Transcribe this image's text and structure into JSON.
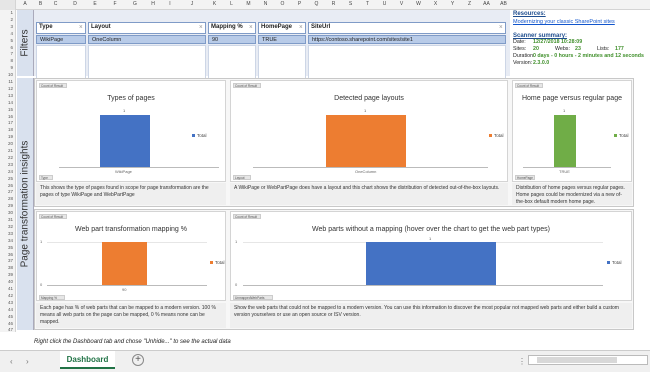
{
  "columns": [
    "A",
    "B",
    "C",
    "D",
    "E",
    "F",
    "G",
    "H",
    "I",
    "J",
    "K",
    "L",
    "M",
    "N",
    "O",
    "P",
    "Q",
    "R",
    "S",
    "T",
    "U",
    "V",
    "W",
    "X",
    "Y",
    "Z",
    "AA",
    "AB"
  ],
  "rows": [
    "1",
    "2",
    "3",
    "4",
    "5",
    "6",
    "7",
    "8",
    "9",
    "10",
    "11",
    "12",
    "13",
    "14",
    "15",
    "16",
    "17",
    "18",
    "19",
    "20",
    "21",
    "22",
    "23",
    "24",
    "25",
    "26",
    "27",
    "28",
    "29",
    "30",
    "31",
    "32",
    "33",
    "34",
    "35",
    "36",
    "37",
    "38",
    "39",
    "40",
    "41",
    "42",
    "43",
    "44",
    "45",
    "46",
    "47"
  ],
  "bands": {
    "filters": "Filters",
    "insights": "Page transformation insights"
  },
  "filters": [
    {
      "label": "Type",
      "value": "WikiPage"
    },
    {
      "label": "Layout",
      "value": "OneColumn"
    },
    {
      "label": "Mapping %",
      "value": "90"
    },
    {
      "label": "HomePage",
      "value": "TRUE"
    },
    {
      "label": "SiteUrl",
      "value": "https://contoso.sharepoint.com/sites/site1"
    }
  ],
  "resources": {
    "title": "Resources:",
    "link": "Modernizing your classic SharePoint sites",
    "summary_title": "Scanner summary:",
    "date_label": "Date:",
    "date_value": "12/27/2018 10:28:09",
    "sites_label": "Sites:",
    "sites_value": "20",
    "webs_label": "Webs:",
    "webs_value": "23",
    "lists_label": "Lists:",
    "lists_value": "177",
    "duration_label": "Duration:",
    "duration_value": "0 days - 0 hours - 2 minutes and 12 seconds",
    "version_label": "Version:",
    "version_value": "2.3.0.0"
  },
  "charts": {
    "types": {
      "title": "Types of pages",
      "chip": "Count of Result",
      "filter_chip": "Type",
      "legend": "Total",
      "category": "WikiPage",
      "value_label": "1"
    },
    "layouts": {
      "title": "Detected page layouts",
      "chip": "Count of Result",
      "filter_chip": "Layout",
      "legend": "Total",
      "category": "OneColumn",
      "value_label": "1"
    },
    "home": {
      "title": "Home page versus regular page",
      "chip": "Count of Result",
      "filter_chip": "HomePage",
      "legend": "Total",
      "category": "TRUE",
      "value_label": "1"
    },
    "mapping": {
      "title": "Web part transformation mapping %",
      "chip": "Count of Result",
      "filter_chip": "Mapping %",
      "legend": "Total",
      "category": "90",
      "value_label": "1"
    },
    "webparts": {
      "title": "Web parts without a mapping (hover over the chart to get the web part types)",
      "chip": "Count of Result",
      "filter_chip": "UnmappedWebParts",
      "legend": "Total",
      "value_label": "1"
    }
  },
  "descriptions": {
    "types": "This shows the type of pages found in scope for page transformation are the pages of type WikiPage and WebPartPage",
    "layouts": "A WikiPage or WebPartPage does have a layout and this chart shows the distribution of detected out-of-the-box layouts.",
    "home": "Distribution of home pages versus regular pages. Home pages could be modernized via a new of-the-box default modern home page.",
    "mapping": "Each page has % of web parts that can be mapped to a modern version. 100 % means all web parts on the page can be mapped, 0 % means none can be mapped.",
    "webparts": "Show the web parts that could not be mapped to a modern version. You can use this information to discover the most popular not mapped web parts and either build a custom version yourselves or use an open source or ISV version."
  },
  "footer_note": "Right click the Dashboard tab and chose \"Unhide...\" to see the actual data",
  "sheet_tab": "Dashboard",
  "colors": {
    "blue": "#4472c4",
    "orange": "#ed7d31",
    "green": "#70ad47",
    "excel_green": "#217346"
  },
  "chart_data": [
    {
      "type": "bar",
      "title": "Types of pages",
      "categories": [
        "WikiPage"
      ],
      "series": [
        {
          "name": "Total",
          "values": [
            1
          ]
        }
      ],
      "ylim": [
        0,
        1.2
      ]
    },
    {
      "type": "bar",
      "title": "Detected page layouts",
      "categories": [
        "OneColumn"
      ],
      "series": [
        {
          "name": "Total",
          "values": [
            1
          ]
        }
      ],
      "ylim": [
        0,
        1.2
      ]
    },
    {
      "type": "bar",
      "title": "Home page versus regular page",
      "categories": [
        "TRUE"
      ],
      "series": [
        {
          "name": "Total",
          "values": [
            1
          ]
        }
      ],
      "ylim": [
        0,
        1.2
      ]
    },
    {
      "type": "bar",
      "title": "Web part transformation mapping %",
      "categories": [
        "90"
      ],
      "series": [
        {
          "name": "Total",
          "values": [
            1
          ]
        }
      ],
      "ylim": [
        0,
        1.2
      ],
      "yticks": [
        0,
        1
      ]
    },
    {
      "type": "bar",
      "title": "Web parts without a mapping (hover over the chart to get the web part types)",
      "categories": [
        ""
      ],
      "series": [
        {
          "name": "Total",
          "values": [
            1
          ]
        }
      ],
      "ylim": [
        0,
        1.2
      ],
      "yticks": [
        0,
        1
      ]
    }
  ]
}
